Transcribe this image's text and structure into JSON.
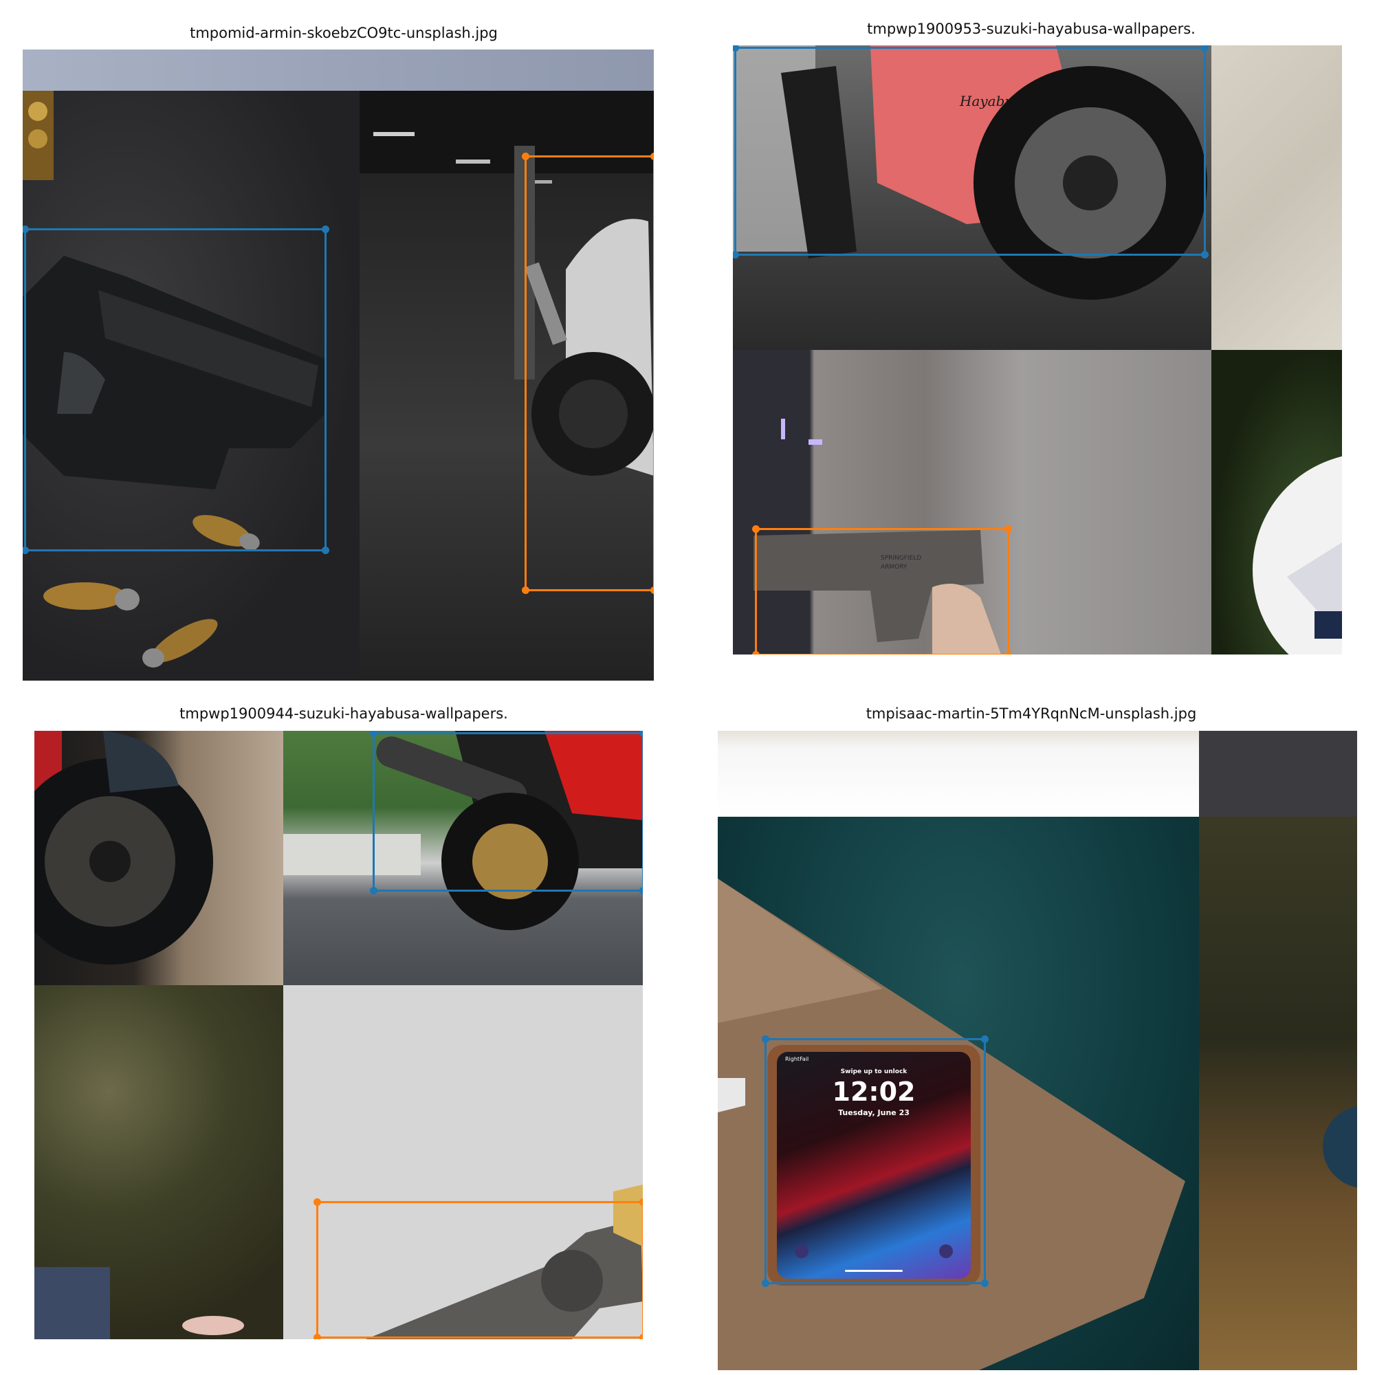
{
  "panels": [
    {
      "title": "tmpomid-armin-skoebzCO9tc-unsplash.jpg"
    },
    {
      "title": "tmpwp1900953-suzuki-hayabusa-wallpapers."
    },
    {
      "title": "tmpwp1900944-suzuki-hayabusa-wallpapers."
    },
    {
      "title": "tmpisaac-martin-5Tm4YRqnNcM-unsplash.jpg"
    }
  ],
  "phone": {
    "time": "12:02",
    "date": "Tuesday, June 23",
    "notice": "Swipe up to unlock",
    "carrier": "RightFail"
  },
  "gun_text": {
    "line1": "SPRINGFIELD",
    "line2": "ARMORY"
  },
  "bike_badge": "Hayabusa",
  "colors": {
    "box_blue": "#1f77b4",
    "box_orange": "#ff7f0e"
  }
}
